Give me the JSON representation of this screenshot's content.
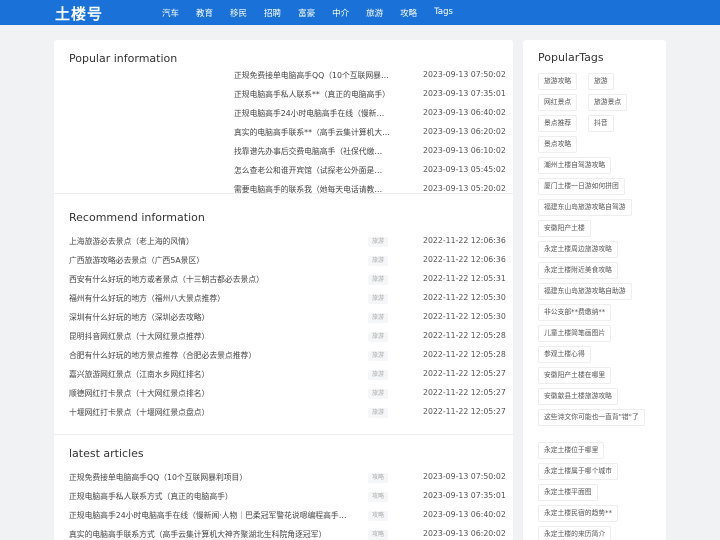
{
  "site": {
    "logo": "土楼号"
  },
  "nav": [
    "汽车",
    "教育",
    "移民",
    "招聘",
    "富豪",
    "中介",
    "旅游",
    "攻略",
    "Tags"
  ],
  "popular": {
    "title": "Popular information",
    "items": [
      {
        "title": "正规免费接单电脑高手QQ（10个互联网暴…",
        "date": "2023-09-13 07:50:02"
      },
      {
        "title": "正规电脑高手私人联系**（真正的电脑高手）",
        "date": "2023-09-13 07:35:01"
      },
      {
        "title": "正规电脑高手24小时电脑高手在线（慢新…",
        "date": "2023-09-13 06:40:02"
      },
      {
        "title": "真实的电脑高手联系**（高手云集计算机大…",
        "date": "2023-09-13 06:20:02"
      },
      {
        "title": "找靠谱先办事后交费电脑高手（社保代缴…",
        "date": "2023-09-13 06:10:02"
      },
      {
        "title": "怎么查老公和谁开宾馆（试探老公外面是…",
        "date": "2023-09-13 05:45:02"
      },
      {
        "title": "需要电脑高手的联系我（她每天电话请教…",
        "date": "2023-09-13 05:20:02"
      }
    ]
  },
  "recommend": {
    "title": "Recommend information",
    "items": [
      {
        "title": "上海旅游必去景点（老上海的风情）",
        "tag": "旅游",
        "date": "2022-11-22 12:06:36"
      },
      {
        "title": "广西旅游攻略必去景点（广西5A景区）",
        "tag": "旅游",
        "date": "2022-11-22 12:06:36"
      },
      {
        "title": "西安有什么好玩的地方或者景点（十三朝古都必去景点）",
        "tag": "旅游",
        "date": "2022-11-22 12:05:31"
      },
      {
        "title": "福州有什么好玩的地方（福州八大景点推荐）",
        "tag": "旅游",
        "date": "2022-11-22 12:05:30"
      },
      {
        "title": "深圳有什么好玩的地方（深圳必去攻略）",
        "tag": "旅游",
        "date": "2022-11-22 12:05:30"
      },
      {
        "title": "昆明抖音网红景点（十大网红景点推荐）",
        "tag": "旅游",
        "date": "2022-11-22 12:05:28"
      },
      {
        "title": "合肥有什么好玩的地方景点推荐（合肥必去景点推荐）",
        "tag": "旅游",
        "date": "2022-11-22 12:05:28"
      },
      {
        "title": "嘉兴旅游网红景点（江南水乡网红排名）",
        "tag": "旅游",
        "date": "2022-11-22 12:05:27"
      },
      {
        "title": "顺德网红打卡景点（十大网红景点排名）",
        "tag": "旅游",
        "date": "2022-11-22 12:05:27"
      },
      {
        "title": "十堰网红打卡景点（十堰网红景点盘点）",
        "tag": "旅游",
        "date": "2022-11-22 12:05:27"
      }
    ]
  },
  "latest": {
    "title": "latest articles",
    "items": [
      {
        "title": "正规免费接单电脑高手QQ（10个互联网暴利项目）",
        "tag": "攻略",
        "date": "2023-09-13 07:50:02"
      },
      {
        "title": "正规电脑高手私人联系方式（真正的电脑高手）",
        "tag": "攻略",
        "date": "2023-09-13 07:35:01"
      },
      {
        "title": "正规电脑高手24小时电脑高手在线（慢新闻·人物｜巴柔冠军警花说嗯编程高手…",
        "tag": "攻略",
        "date": "2023-09-13 06:40:02"
      },
      {
        "title": "真实的电脑高手联系方式（高手云集计算机大神齐聚湖北生科院角逐冠军）",
        "tag": "攻略",
        "date": "2023-09-13 06:20:02"
      }
    ]
  },
  "tags": {
    "title": "PopularTags",
    "items": [
      "旅游攻略",
      "旅游",
      "网红景点",
      "旅游景点",
      "景点推荐",
      "抖音",
      "景点攻略",
      "潮州土楼自驾游攻略",
      "厦门土楼一日游如何拼团",
      "福建东山岛旅游攻略自驾游",
      "安徽阳产土楼",
      "永定土楼周边旅游攻略",
      "永定土楼附近美食攻略",
      "福建东山岛旅游攻略自助游",
      "非公支部**费缴纳**",
      "儿童土楼简笔画图片",
      "参观土楼心得",
      "安徽阳产土楼在哪里",
      "安徽歙县土楼旅游攻略",
      "这些诗文你可能也一直背\"错\"了",
      "永定土楼位于哪里",
      "永定土楼属于哪个城市",
      "永定土楼平面图",
      "永定土楼民宿的趋势**",
      "永定土楼的来历简介"
    ]
  },
  "colors": {
    "brand": "#1a72d8",
    "background": "#f1f2f4"
  }
}
